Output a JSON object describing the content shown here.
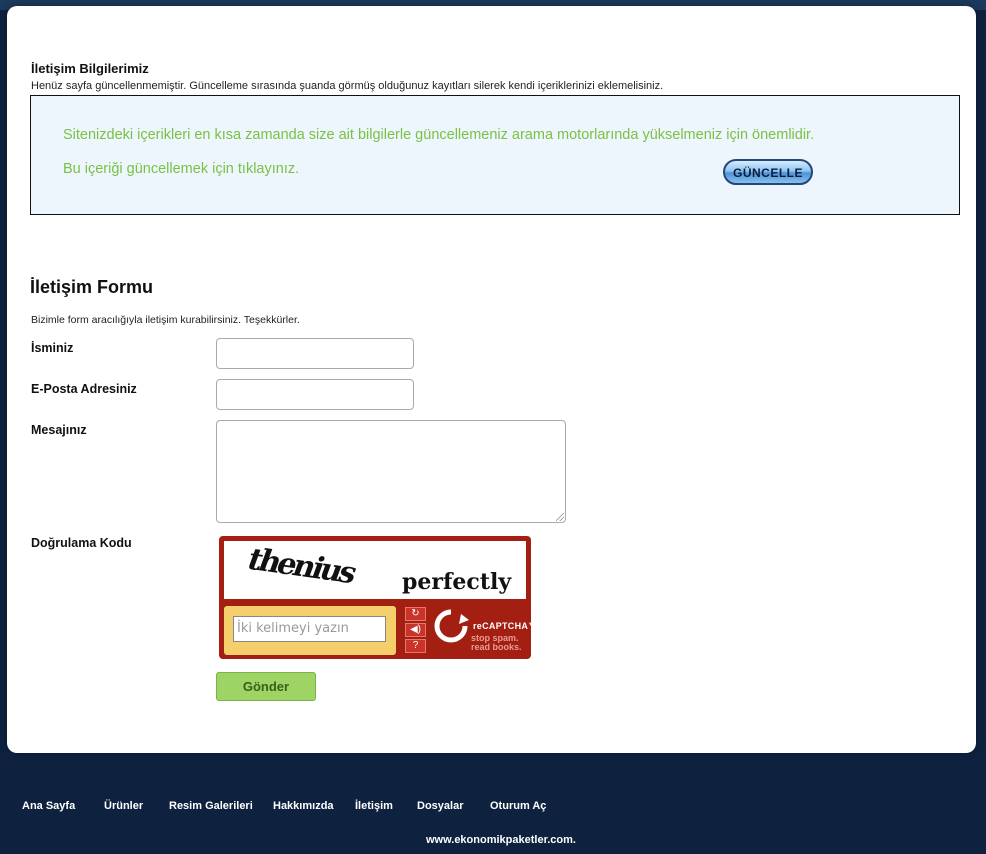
{
  "info": {
    "title": "İletişim Bilgilerimiz",
    "text": "Henüz sayfa güncellenmemiştir. Güncelleme sırasında şuanda görmüş olduğunuz kayıtları silerek kendi içeriklerinizi eklemelisiniz."
  },
  "notice": {
    "line1": "Sitenizdeki içerikleri en kısa zamanda size ait bilgilerle güncellemeniz arama motorlarında yükselmeniz için önemlidir.",
    "line2": "Bu içeriği güncellemek için tıklayınız.",
    "button_label": "GÜNCELLE",
    "text_color": "#7ac143",
    "bg_color": "#eef6fd"
  },
  "form": {
    "title": "İletişim Formu",
    "subtitle": "Bizimle form aracılığıyla iletişim kurabilirsiniz. Teşekkürler.",
    "fields": {
      "name_label": "İsminiz",
      "email_label": "E-Posta Adresiniz",
      "message_label": "Mesajınız",
      "captcha_label": "Doğrulama Kodu"
    },
    "submit_label": "Gönder"
  },
  "captcha": {
    "word1": "thenius",
    "word2": "perfectly",
    "input_placeholder": "İki kelimeyi yazın",
    "brand": "reCAPTCHA™",
    "tagline1": "stop spam.",
    "tagline2": "read books.",
    "icons": [
      "refresh-icon",
      "audio-icon",
      "help-icon"
    ],
    "bg_color": "#a31f12"
  },
  "footer": {
    "nav": [
      "Ana Sayfa",
      "Ürünler",
      "Resim Galerileri",
      "Hakkımızda",
      "İletişim",
      "Dosyalar",
      "Oturum Aç"
    ],
    "url": "www.ekonomikpaketler.com."
  }
}
